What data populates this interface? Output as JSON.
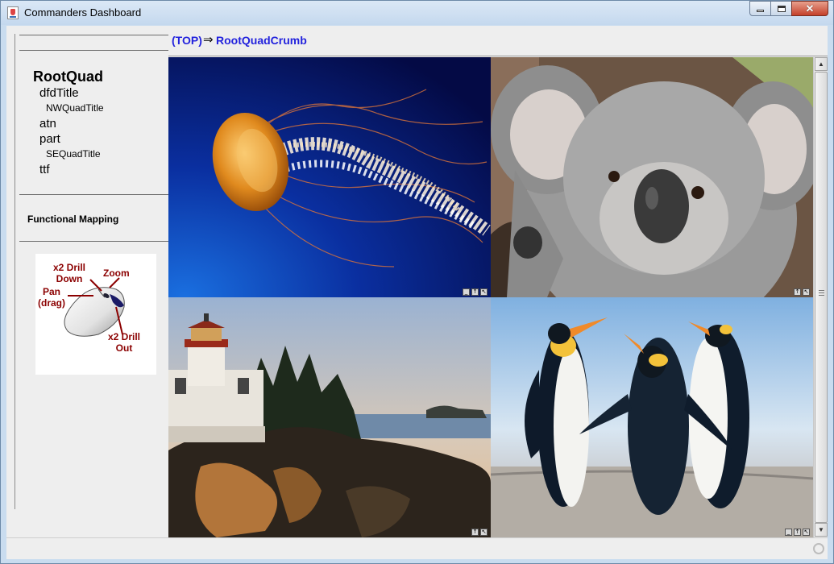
{
  "window": {
    "title": "Commanders Dashboard",
    "minimize_icon": "minimize-icon",
    "maximize_icon": "maximize-icon",
    "close_icon": "close-icon",
    "close_label": "✕"
  },
  "tree": {
    "root": "RootQuad",
    "items": [
      {
        "label": "dfdTitle",
        "level": 1
      },
      {
        "label": "NWQuadTitle",
        "level": 2
      },
      {
        "label": "atn",
        "level": 1
      },
      {
        "label": "part",
        "level": 1
      },
      {
        "label": "SEQuadTitle",
        "level": 2
      },
      {
        "label": "ttf",
        "level": 1
      }
    ]
  },
  "functional_mapping": "Functional Mapping",
  "mouse_help": {
    "drill_down": "x2 Drill Down",
    "zoom": "Zoom",
    "pan": "Pan (drag)",
    "drill_out": "x2 Drill Out"
  },
  "breadcrumb": {
    "top": "(TOP)",
    "arrow": "⇒",
    "current": "RootQuadCrumb"
  },
  "quads": [
    {
      "name": "jellyfish",
      "controls": [
        "minimize",
        "up",
        "zoom"
      ]
    },
    {
      "name": "koala",
      "controls": [
        "up",
        "zoom"
      ]
    },
    {
      "name": "lighthouse",
      "controls": [
        "up",
        "zoom"
      ]
    },
    {
      "name": "penguins",
      "controls": [
        "minimize",
        "up",
        "zoom"
      ]
    }
  ],
  "colors": {
    "crumb": "#2222dd",
    "help_text": "#8b0000"
  }
}
